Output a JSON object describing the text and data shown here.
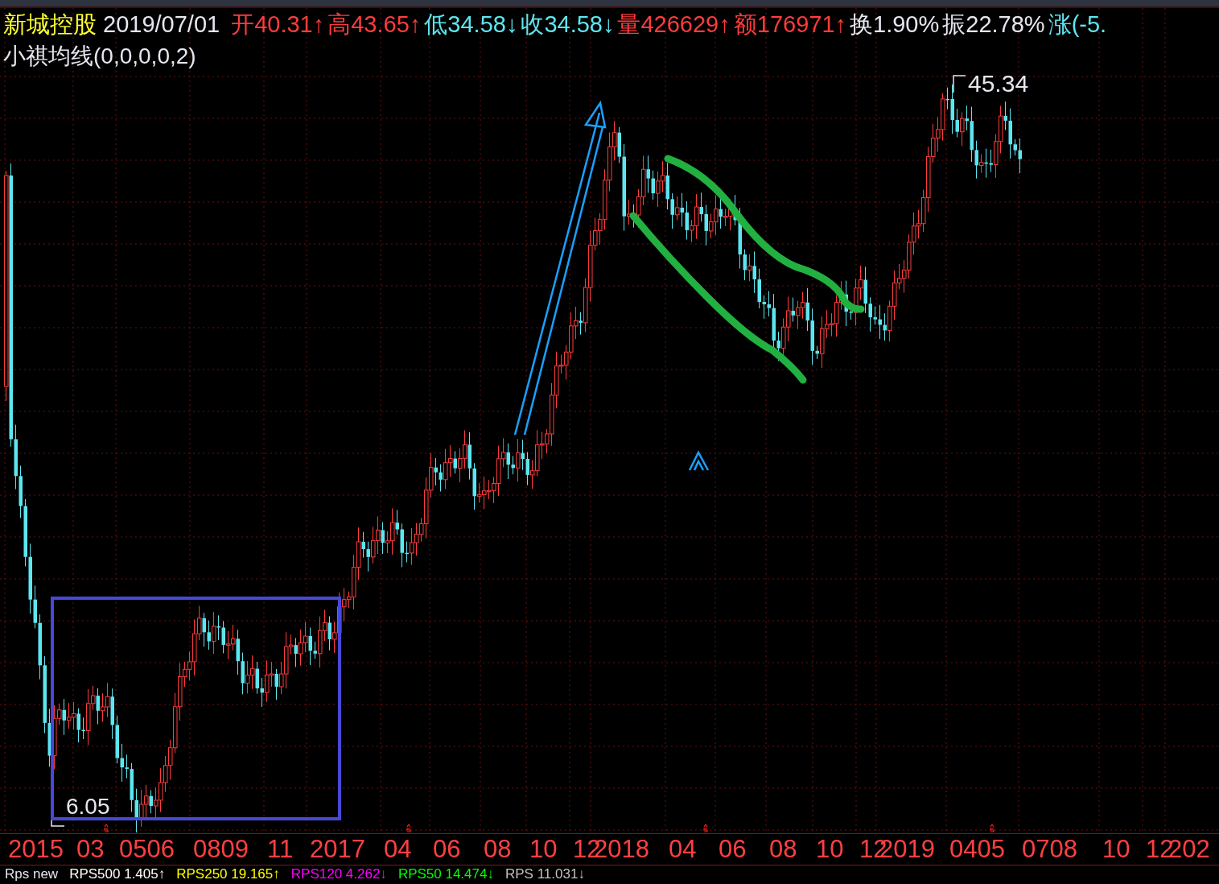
{
  "header": {
    "name": "新城控股",
    "date": "2019/07/01",
    "fields": [
      {
        "label": "开",
        "value": "40.31↑",
        "color": "#ff3c3c"
      },
      {
        "label": "高",
        "value": "43.65↑",
        "color": "#ff3c3c"
      },
      {
        "label": "低",
        "value": "34.58↓",
        "color": "#5ce6f0"
      },
      {
        "label": "收",
        "value": "34.58↓",
        "color": "#5ce6f0"
      },
      {
        "label": "量",
        "value": "426629↑",
        "color": "#ff3c3c"
      },
      {
        "label": "额",
        "value": "176971↑",
        "color": "#ff3c3c"
      },
      {
        "label": "换",
        "value": "1.90%",
        "color": "#e6e6f0"
      },
      {
        "label": "振",
        "value": "22.78%",
        "color": "#e6e6f0"
      },
      {
        "label": "涨",
        "value": "(-5.",
        "color": "#5ce6f0"
      }
    ]
  },
  "indicator": "小祺均线(0,0,0,0,2)",
  "chart": {
    "high_label": "45.34",
    "low_label": "6.05"
  },
  "x_axis": [
    "2015",
    "03",
    "0506",
    "0809",
    "11",
    "2017",
    "04",
    "06",
    "08",
    "10",
    "12",
    "2018",
    "04",
    "06",
    "08",
    "10",
    "12",
    "2019",
    "0405",
    "0708",
    "10",
    "12",
    "202"
  ],
  "rps": {
    "title": "Rps new",
    "items": [
      {
        "label": "RPS500",
        "value": "1.405↑",
        "color": "#ffffff"
      },
      {
        "label": "RPS250",
        "value": "19.165↑",
        "color": "#ffff00"
      },
      {
        "label": "RPS120",
        "value": "4.262↓",
        "color": "#ff00ff"
      },
      {
        "label": "RPS50",
        "value": "14.474↓",
        "color": "#00ff00"
      },
      {
        "label": "RPS",
        "value": "11.031↓",
        "color": "#c0c0c0"
      }
    ]
  }
}
